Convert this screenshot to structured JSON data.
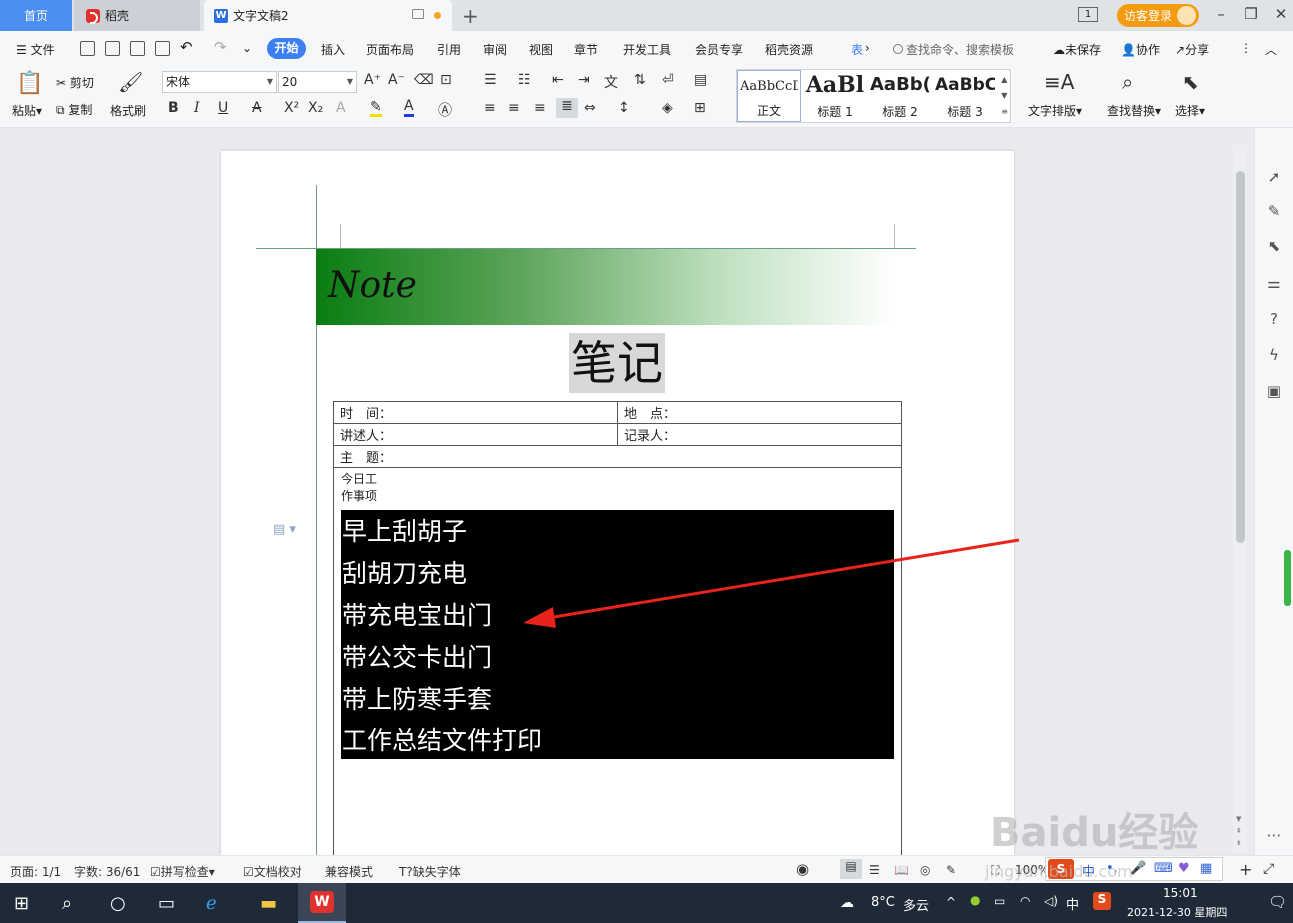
{
  "titlebar": {
    "tabs": [
      {
        "label": "首页"
      },
      {
        "label": "稻壳"
      },
      {
        "label": "文字文稿2"
      }
    ],
    "window_count": "1",
    "login_label": "访客登录"
  },
  "menubar": {
    "file_label": "文件",
    "items": [
      "开始",
      "插入",
      "页面布局",
      "引用",
      "审阅",
      "视图",
      "章节",
      "开发工具",
      "会员专享",
      "稻壳资源",
      "表"
    ],
    "search_placeholder": "查找命令、搜索模板",
    "unsaved_label": "未保存",
    "collab_label": "协作",
    "share_label": "分享"
  },
  "toolbar": {
    "paste_label": "粘贴",
    "cut_label": "剪切",
    "copy_label": "复制",
    "format_painter_label": "格式刷",
    "font_name": "宋体",
    "font_size": "20",
    "styles": [
      {
        "sample": "AaBbCcDd",
        "name": "正文"
      },
      {
        "sample": "AaBl",
        "name": "标题 1"
      },
      {
        "sample": "AaBb(",
        "name": "标题 2"
      },
      {
        "sample": "AaBbC",
        "name": "标题 3"
      }
    ],
    "text_layout_label": "文字排版",
    "find_replace_label": "查找替换",
    "select_label": "选择"
  },
  "document": {
    "banner_text": "Note",
    "title": "笔记",
    "table": {
      "time_label": "时　间：",
      "place_label": "地　点：",
      "speaker_label": "讲述人：",
      "recorder_label": "记录人：",
      "topic_label": "主　题：",
      "work_label_line1": "今日工",
      "work_label_line2": "作事项"
    },
    "tasks": [
      "早上刮胡子",
      "刮胡刀充电",
      "带充电宝出门",
      "带公交卡出门",
      "带上防寒手套",
      "工作总结文件打印"
    ]
  },
  "statusbar": {
    "page": "页面: 1/1",
    "word_count": "字数: 36/61",
    "spell_check": "拼写检查",
    "doc_check": "文档校对",
    "compat_mode": "兼容模式",
    "missing_font": "缺失字体",
    "zoom": "100%"
  },
  "taskbar": {
    "weather_temp": "8°C",
    "weather_desc": "多云",
    "ime_lang": "中",
    "time": "15:01",
    "date": "2021-12-30 星期四"
  },
  "ime_bar": {
    "mode": "中"
  },
  "watermark": {
    "text": "Baidu经验",
    "sub": "jingyan.baidu.com"
  },
  "colors": {
    "accent": "#3b7ff2",
    "login": "#f39c12",
    "banner_green": "#0a7d12",
    "annotation_arrow": "#e8231b"
  }
}
